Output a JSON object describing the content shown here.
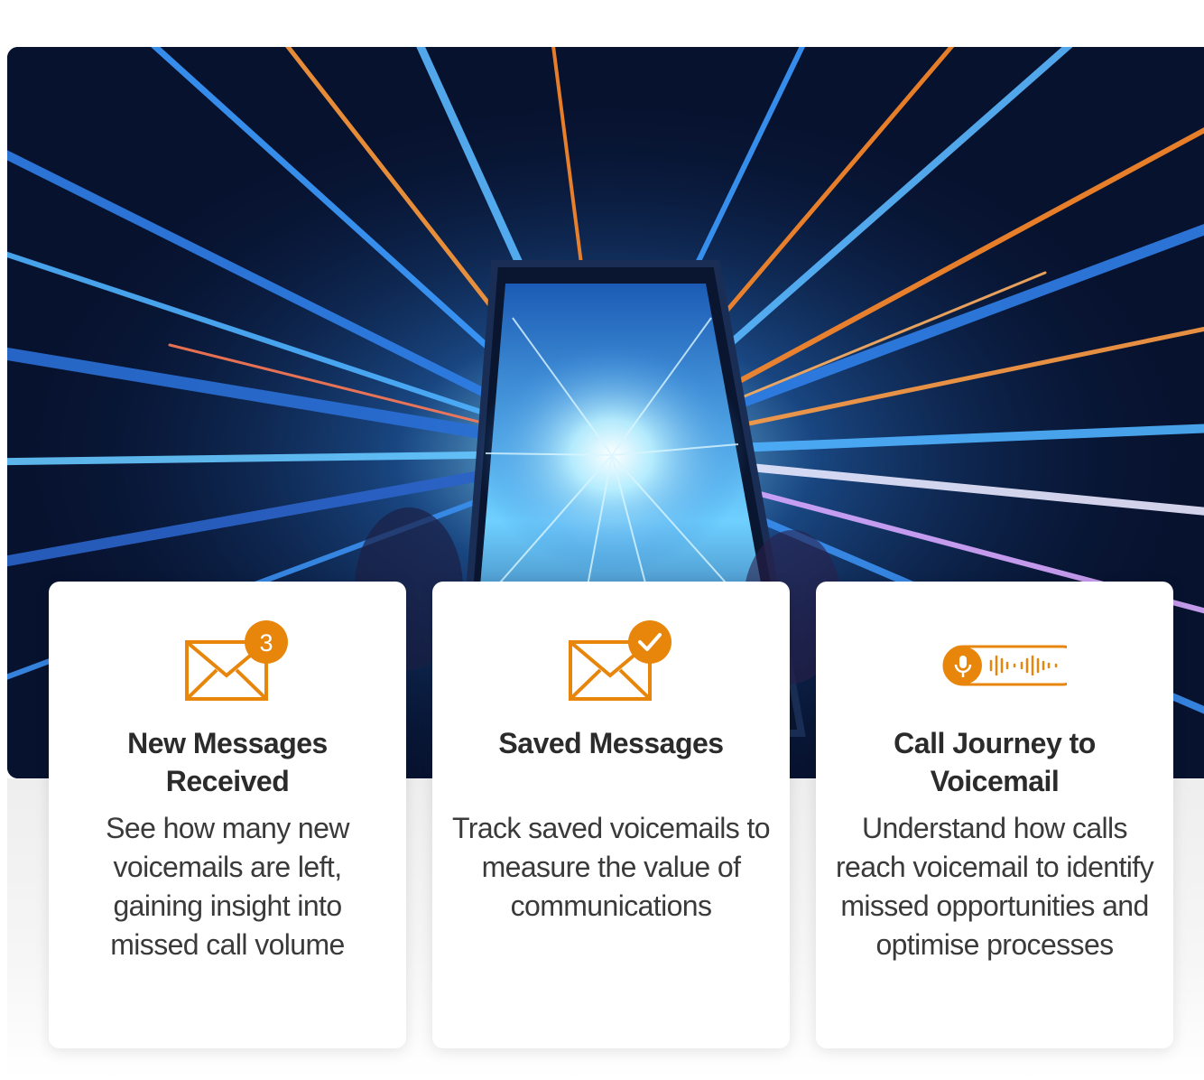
{
  "colors": {
    "accent": "#e8860c",
    "title_text": "#2b2b2b",
    "body_text": "#3a3a3a",
    "card_bg": "#ffffff"
  },
  "hero": {
    "icon": "phone-light-speed-image"
  },
  "cards": [
    {
      "icon": "envelope-badge-icon",
      "badge": "3",
      "title": "New Messages Received",
      "description": "See how many new voicemails are left, gaining insight into missed call volume"
    },
    {
      "icon": "envelope-check-icon",
      "title": "Saved Messages",
      "description": "Track saved voicemails to measure the value of communications"
    },
    {
      "icon": "voicemail-waveform-icon",
      "title": "Call Journey to Voicemail",
      "description": "Understand how calls reach voicemail to identify missed opportunities and optimise processes"
    }
  ]
}
